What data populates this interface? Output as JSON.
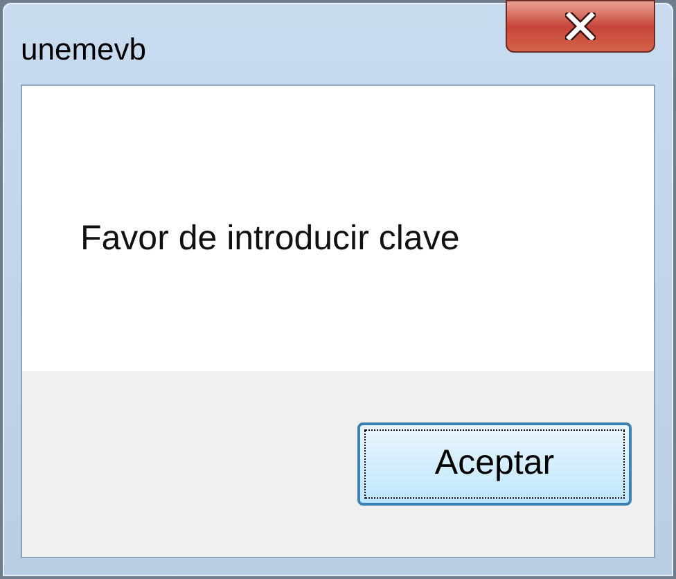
{
  "window": {
    "title": "unemevb"
  },
  "message": "Favor de introducir clave",
  "buttons": [
    {
      "label": "Aceptar",
      "selected": true
    }
  ]
}
